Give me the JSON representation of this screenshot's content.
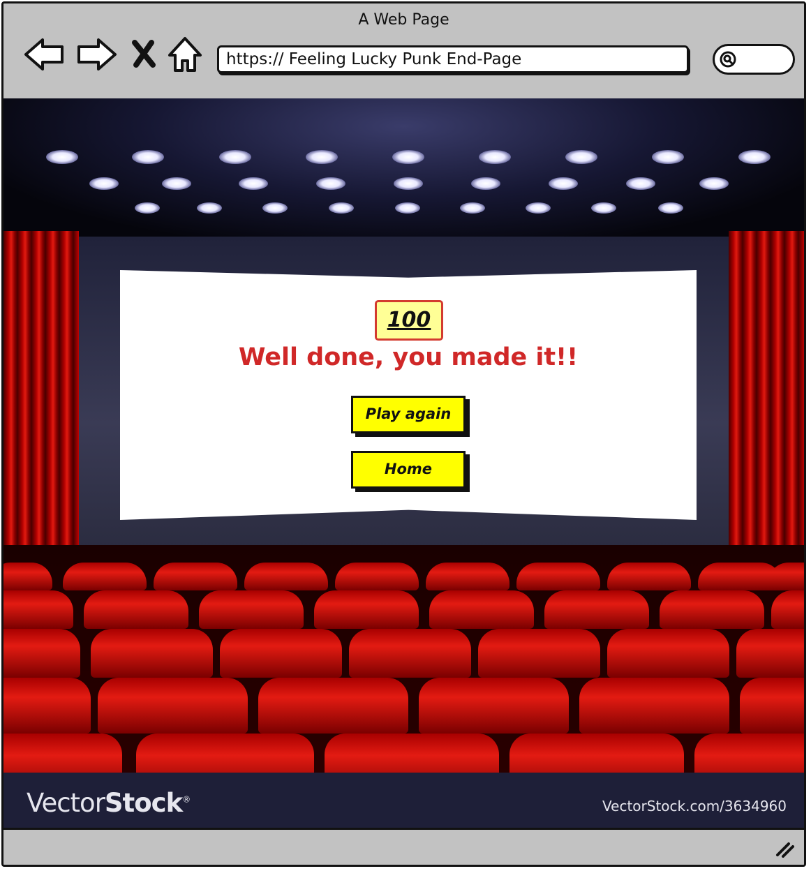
{
  "window": {
    "title": "A Web Page"
  },
  "address_bar": {
    "url": "https:// Feeling Lucky Punk End-Page"
  },
  "nav_icons": [
    "back-arrow-icon",
    "forward-arrow-icon",
    "close-x-icon",
    "home-icon",
    "search-icon"
  ],
  "game": {
    "score": "100",
    "message": "Well done, you made it!!",
    "play_again_label": "Play again",
    "home_label": "Home"
  },
  "watermark": {
    "brand_light": "Vector",
    "brand_bold": "Stock",
    "registered": "®",
    "url": "VectorStock.com/3634960"
  },
  "colors": {
    "button_bg": "#ffff00",
    "message_red": "#d02828",
    "score_border": "#d33b2f",
    "score_bg": "#ffff96",
    "chrome_gray": "#c2c2c2"
  }
}
